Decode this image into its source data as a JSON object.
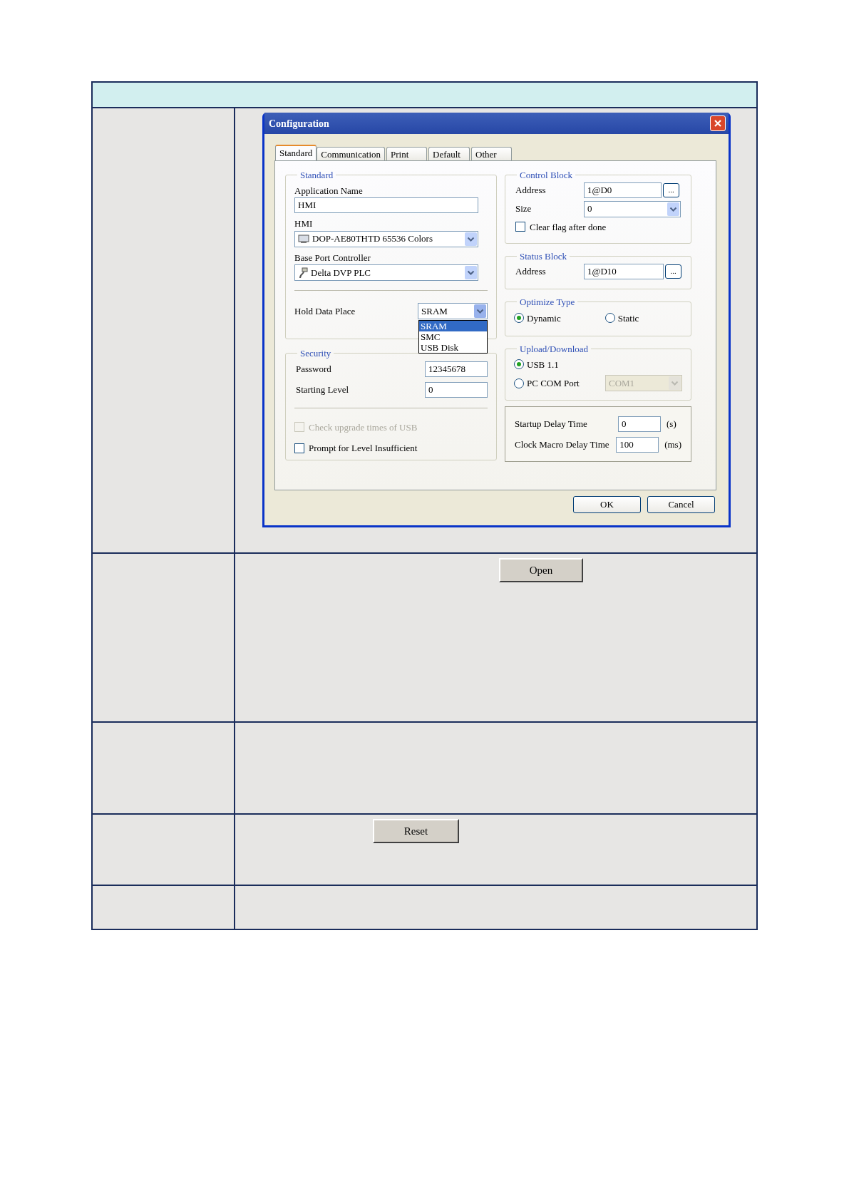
{
  "table": {
    "rows": [
      {
        "kind": "dialog"
      },
      {
        "kind": "button",
        "button": "Open"
      },
      {
        "kind": "empty"
      },
      {
        "kind": "button",
        "button": "Reset"
      },
      {
        "kind": "empty"
      }
    ]
  },
  "dialog": {
    "title": "Configuration",
    "tabs": [
      {
        "label": "Standard",
        "selected": true
      },
      {
        "label": "Communication",
        "selected": false
      },
      {
        "label": "Print",
        "selected": false
      },
      {
        "label": "Default",
        "selected": false
      },
      {
        "label": "Other",
        "selected": false
      }
    ],
    "standard_group": {
      "title": "Standard",
      "application_name": {
        "label": "Application Name",
        "value": "HMI"
      },
      "hmi": {
        "label": "HMI",
        "value": "DOP-AE80THTD 65536 Colors"
      },
      "base_port_controller": {
        "label": "Base Port Controller",
        "value": "Delta DVP PLC"
      },
      "hold_data_place": {
        "label": "Hold Data Place",
        "value": "SRAM",
        "expanded": true,
        "options": [
          {
            "label": "SRAM",
            "selected": true
          },
          {
            "label": "SMC",
            "selected": false
          },
          {
            "label": "USB Disk",
            "selected": false
          }
        ]
      }
    },
    "security_group": {
      "title": "Security",
      "password": {
        "label": "Password",
        "value": "12345678"
      },
      "starting_level": {
        "label": "Starting Level",
        "value": "0"
      }
    },
    "checkboxes": [
      {
        "label": "Check upgrade times of USB",
        "checked": false,
        "disabled": true
      },
      {
        "label": "Prompt for Level Insufficient",
        "checked": false,
        "disabled": false
      }
    ],
    "control_block": {
      "title": "Control Block",
      "address": {
        "label": "Address",
        "value": "1@D0",
        "button": "..."
      },
      "size": {
        "label": "Size",
        "value": "0"
      },
      "clear_flag": {
        "label": "Clear flag after done",
        "checked": false
      }
    },
    "status_block": {
      "title": "Status Block",
      "address": {
        "label": "Address",
        "value": "1@D10",
        "button": "..."
      }
    },
    "optimize_type": {
      "title": "Optimize Type",
      "options": [
        {
          "label": "Dynamic",
          "selected": true
        },
        {
          "label": "Static",
          "selected": false
        }
      ]
    },
    "upload_download": {
      "title": "Upload/Download",
      "options": [
        {
          "label": "USB 1.1",
          "selected": true
        },
        {
          "label": "PC COM Port",
          "selected": false
        }
      ],
      "com_port": {
        "value": "COM1",
        "disabled": true
      }
    },
    "delays": [
      {
        "label": "Startup Delay Time",
        "value": "0",
        "unit": "(s)"
      },
      {
        "label": "Clock Macro Delay Time",
        "value": "100",
        "unit": "(ms)"
      }
    ],
    "buttons": [
      "OK",
      "Cancel"
    ]
  }
}
